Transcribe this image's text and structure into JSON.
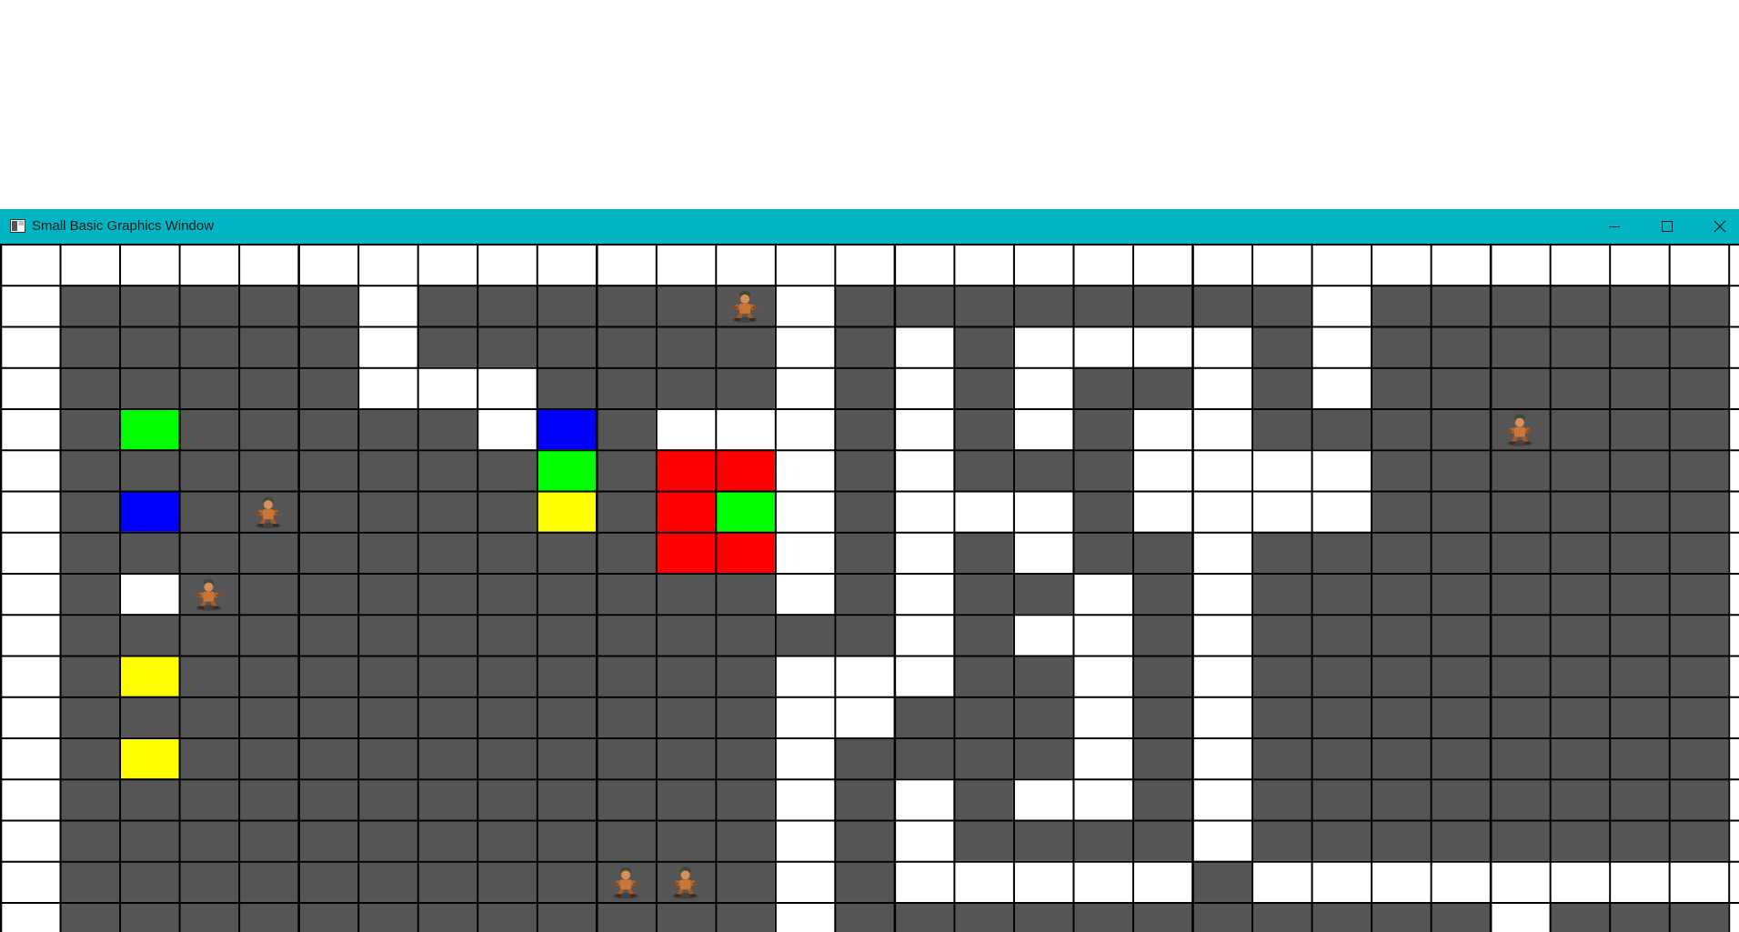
{
  "window": {
    "title": "Small Basic Graphics Window",
    "titlebar_color": "#00b4c4",
    "controls": [
      "minimize-icon",
      "maximize-icon",
      "close-icon"
    ]
  },
  "board": {
    "columns": 30,
    "rows": 17,
    "palette": {
      "W": "#ffffff",
      "D": "#555555",
      "G": "#00ff00",
      "B": "#0000ff",
      "Y": "#ffff00",
      "R": "#ff0000",
      "grid_line": "#000000"
    },
    "cells": [
      "WWWWWWWWWWWWWWWWWWWWWWWWWWWWWW",
      "WDDDDDWDDDDDDWDDDDDDDDWDDDDDDW",
      "WDDDDDWDDDDDDWDWDWWWWDWDDDDDDW",
      "WDDDDDWWWDDDDWDWDWDDWDWDDDDDDW",
      "WDGDDDDDWBDWWWDWDWDWWDDDDDDDDW",
      "WDDDDDDDDGDRRWDWDDDWWWWDDDDDDW",
      "WDBDDDDDDYDRGWDWWWDWWWWDDDDDDW",
      "WDDDDDDDDDDRRWDWDWDDWDDDDDDDDW",
      "WDWDDDDDDDDDDWDWDDWDWDDDDDDDDW",
      "WDDDDDDDDDDDDDDWDWWDWDDDDDDDDW",
      "WDYDDDDDDDDDDWWWDDWDWDDDDDDDDW",
      "WDDDDDDDDDDDDWWDDDWDWDDDDDDDDW",
      "WDYDDDDDDDDDDWDDDDWDWDDDDDDDDW",
      "WDDDDDDDDDDDDWDWDWWDWDDDDDDDDW",
      "WDDDDDDDDDDDDWDWDDDDWDDDDDDDDW",
      "WDDDDDDDDDDDDWDWWWWWDWWWWWWWWW",
      "WDDDDDDDDDDDDWDDDDDDDDDDDWDDDW"
    ],
    "characters": [
      {
        "col": 12,
        "row": 1
      },
      {
        "col": 25,
        "row": 4
      },
      {
        "col": 4,
        "row": 6
      },
      {
        "col": 3,
        "row": 8
      },
      {
        "col": 10,
        "row": 15
      },
      {
        "col": 11,
        "row": 15
      }
    ]
  }
}
